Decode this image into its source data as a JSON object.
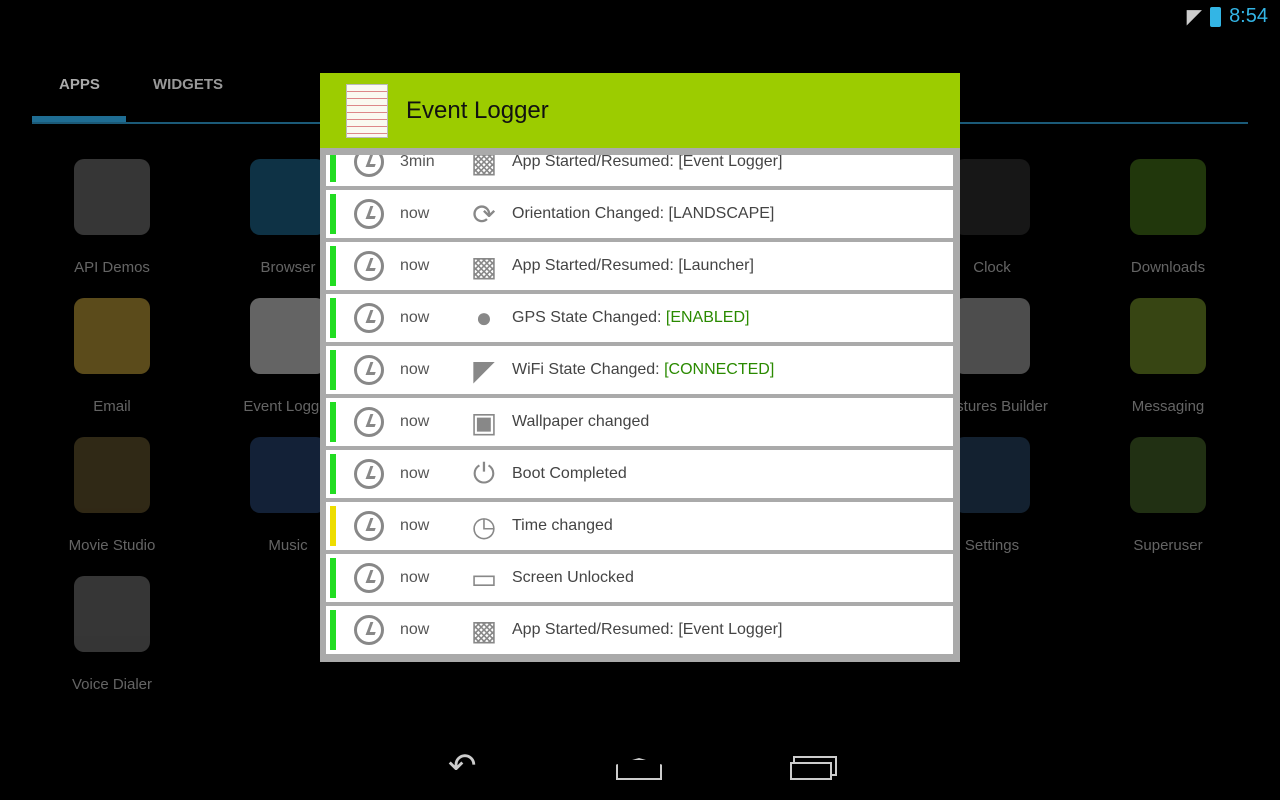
{
  "status": {
    "time": "8:54",
    "wifi_icon": "wifi-icon",
    "battery_icon": "battery-icon"
  },
  "tabs": [
    {
      "label": "APPS",
      "active": true
    },
    {
      "label": "WIDGETS",
      "active": false
    }
  ],
  "apps": [
    {
      "label": "API Demos",
      "color": "#777"
    },
    {
      "label": "Browser",
      "color": "#1e6e99"
    },
    {
      "label": "Clock",
      "color": "#333"
    },
    {
      "label": "Downloads",
      "color": "#4a7a1a"
    },
    {
      "label": "Email",
      "color": "#c9a63c"
    },
    {
      "label": "Event Logger",
      "color": "#ddd"
    },
    {
      "label": "Gestures Builder",
      "color": "#aaa"
    },
    {
      "label": "Messaging",
      "color": "#7a9a2a"
    },
    {
      "label": "Movie Studio",
      "color": "#6a5a30"
    },
    {
      "label": "Music",
      "color": "#2a4a7a"
    },
    {
      "label": "Settings",
      "color": "#2a4a6a"
    },
    {
      "label": "Superuser",
      "color": "#4a6a2a"
    },
    {
      "label": "Voice Dialer",
      "color": "#777"
    }
  ],
  "dialog": {
    "title": "Event Logger",
    "header_color": "#9ccc00",
    "events": [
      {
        "time": "3min",
        "icon": "android-icon",
        "text": "App Started/Resumed: [Event Logger]",
        "highlight": "",
        "bar": "#22dd22"
      },
      {
        "time": "now",
        "icon": "rotate-icon",
        "text": "Orientation Changed: [LANDSCAPE]",
        "highlight": "",
        "bar": "#22dd22"
      },
      {
        "time": "now",
        "icon": "android-icon",
        "text": "App Started/Resumed: [Launcher]",
        "highlight": "",
        "bar": "#22dd22"
      },
      {
        "time": "now",
        "icon": "location-pin-icon",
        "text": "GPS State Changed: ",
        "highlight": "[ENABLED]",
        "bar": "#22dd22"
      },
      {
        "time": "now",
        "icon": "wifi-icon",
        "text": "WiFi State Changed: ",
        "highlight": "[CONNECTED]",
        "bar": "#22dd22"
      },
      {
        "time": "now",
        "icon": "image-icon",
        "text": "Wallpaper changed",
        "highlight": "",
        "bar": "#22dd22"
      },
      {
        "time": "now",
        "icon": "power-icon",
        "text": "Boot Completed",
        "highlight": "",
        "bar": "#22dd22"
      },
      {
        "time": "now",
        "icon": "clock-icon",
        "text": "Time changed",
        "highlight": "",
        "bar": "#eedd00"
      },
      {
        "time": "now",
        "icon": "monitor-icon",
        "text": "Screen Unlocked",
        "highlight": "",
        "bar": "#22dd22"
      },
      {
        "time": "now",
        "icon": "android-icon",
        "text": "App Started/Resumed: [Event Logger]",
        "highlight": "",
        "bar": "#22dd22"
      }
    ]
  },
  "nav": {
    "back": "back-icon",
    "home": "home-icon",
    "recents": "recents-icon"
  }
}
